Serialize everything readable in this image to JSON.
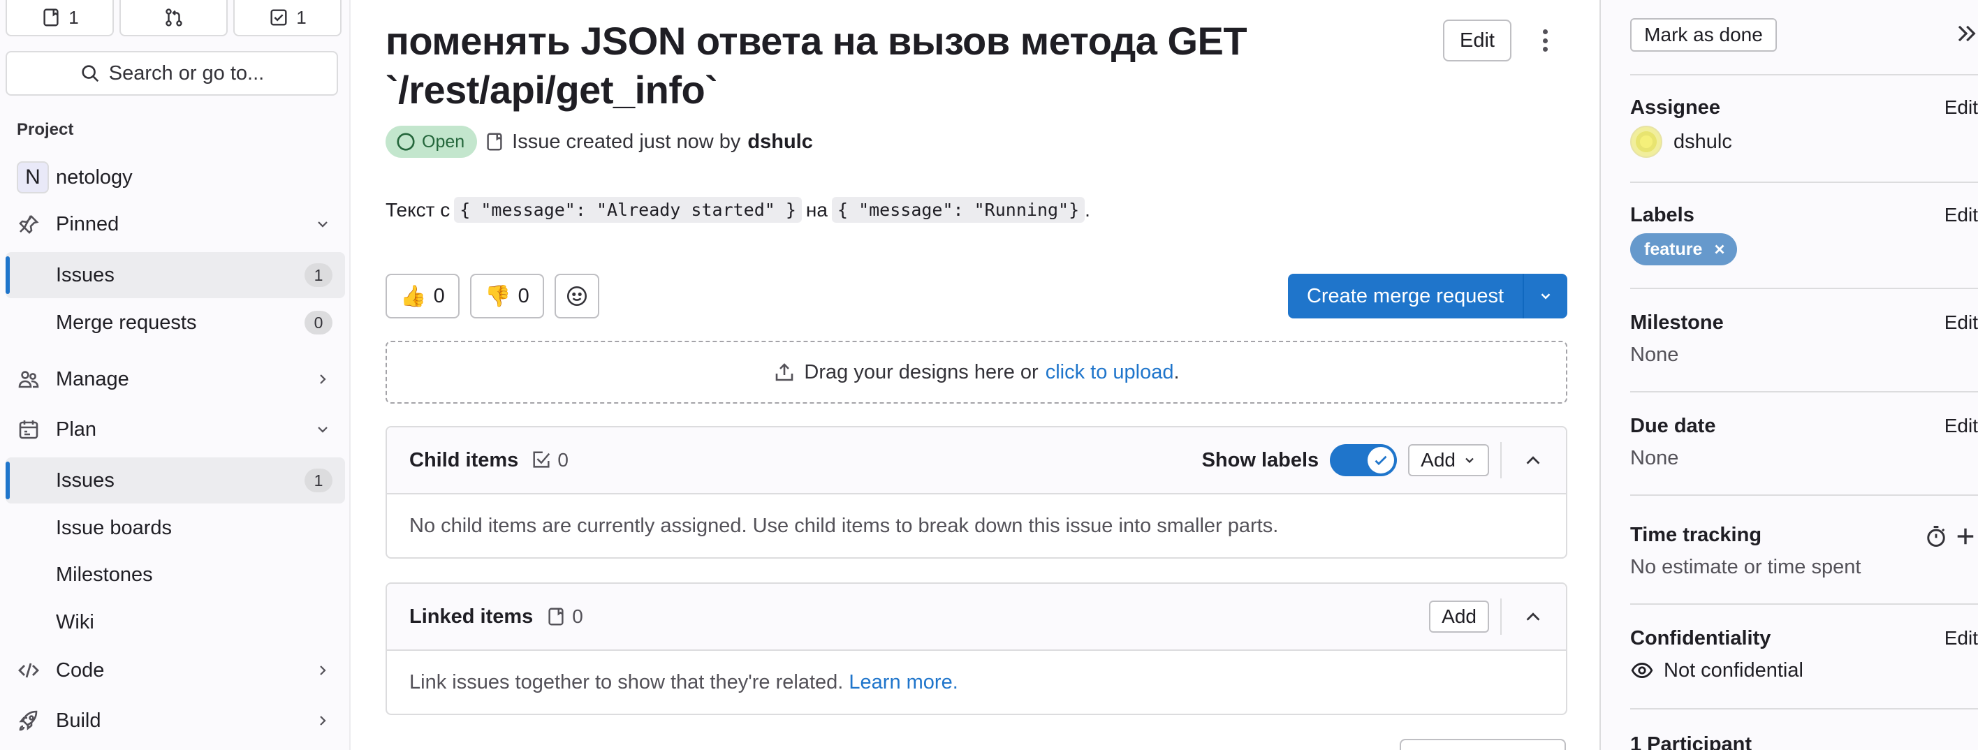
{
  "top_counters": [
    {
      "icon": "issue-icon",
      "count": "1"
    },
    {
      "icon": "merge-request-icon",
      "count": ""
    },
    {
      "icon": "todo-icon",
      "count": "1"
    }
  ],
  "sidebar": {
    "search_label": "Search or go to...",
    "section_label": "Project",
    "project": {
      "avatar_letter": "N",
      "name": "netology"
    },
    "pinned": {
      "label": "Pinned",
      "items": [
        {
          "label": "Issues",
          "badge": "1"
        },
        {
          "label": "Merge requests",
          "badge": "0"
        }
      ]
    },
    "manage": "Manage",
    "plan": {
      "label": "Plan",
      "items": [
        {
          "label": "Issues",
          "badge": "1"
        },
        {
          "label": "Issue boards"
        },
        {
          "label": "Milestones"
        },
        {
          "label": "Wiki"
        }
      ]
    },
    "code": "Code",
    "build": "Build"
  },
  "issue": {
    "title": "поменять JSON ответа на вызов метода GET `/rest/api/get_info`",
    "edit_label": "Edit",
    "status": "Open",
    "meta_prefix": "Issue created just now by",
    "author": "dshulc",
    "description": {
      "prefix": "Текст с",
      "code1": "{ \"message\": \"Already started\" }",
      "middle": "на",
      "code2": "{ \"message\": \"Running\"}",
      "suffix": "."
    },
    "thumbs_up": "0",
    "thumbs_down": "0",
    "create_mr_label": "Create merge request",
    "dropzone": {
      "text": "Drag your designs here or",
      "link": "click to upload",
      "suffix": "."
    }
  },
  "child_items": {
    "title": "Child items",
    "count": "0",
    "show_labels": "Show labels",
    "show_labels_enabled": true,
    "add_label": "Add",
    "empty_text": "No child items are currently assigned. Use child items to break down this issue into smaller parts."
  },
  "linked_items": {
    "title": "Linked items",
    "count": "0",
    "add_label": "Add",
    "empty_text": "Link issues together to show that they're related.",
    "learn_more": "Learn more."
  },
  "right_sidebar": {
    "mark_done": "Mark as done",
    "assignee": {
      "heading": "Assignee",
      "edit": "Edit",
      "name": "dshulc"
    },
    "labels": {
      "heading": "Labels",
      "edit": "Edit",
      "items": [
        {
          "name": "feature",
          "color": "#6699cc"
        }
      ]
    },
    "milestone": {
      "heading": "Milestone",
      "edit": "Edit",
      "value": "None"
    },
    "due_date": {
      "heading": "Due date",
      "edit": "Edit",
      "value": "None"
    },
    "time_tracking": {
      "heading": "Time tracking",
      "value": "No estimate or time spent"
    },
    "confidentiality": {
      "heading": "Confidentiality",
      "edit": "Edit",
      "value": "Not confidential"
    },
    "participants": {
      "heading": "1 Participant"
    }
  },
  "colors": {
    "accent": "#1f75cb",
    "open_bg": "#c3e6cd",
    "open_fg": "#24663b",
    "label": "#6699cc"
  }
}
